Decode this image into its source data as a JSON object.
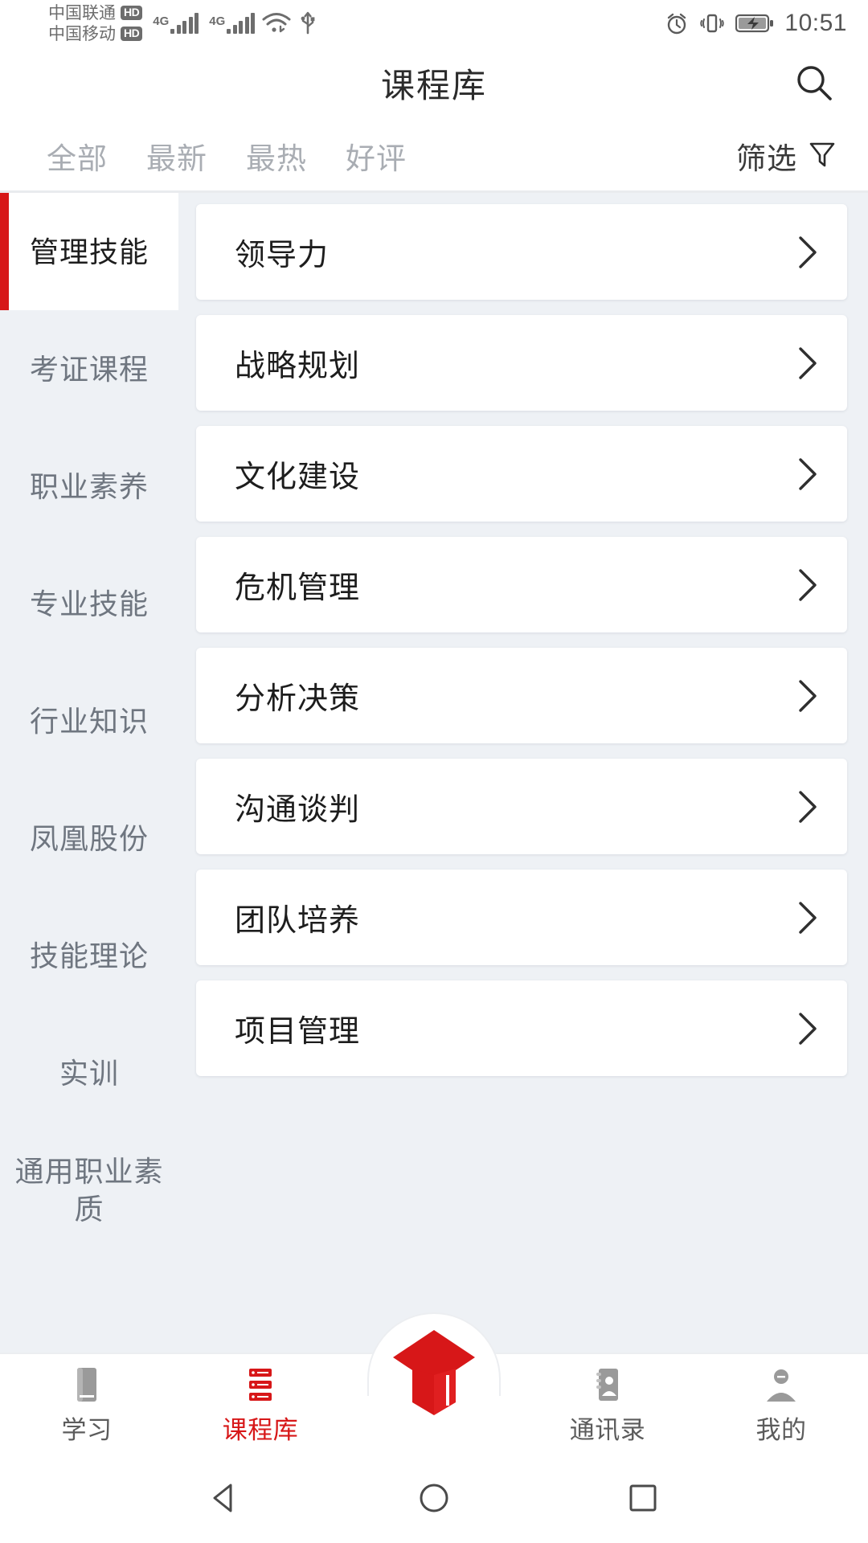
{
  "status_bar": {
    "carrier_1": "中国联通",
    "carrier_1_badge": "HD",
    "carrier_2": "中国移动",
    "carrier_2_badge": "HD",
    "network_1": "4G",
    "network_2": "4G",
    "icons": [
      "wifi-icon",
      "usb-icon",
      "alarm-icon",
      "vibrate-icon",
      "battery-charging-icon"
    ],
    "time": "10:51"
  },
  "header": {
    "title": "课程库",
    "search_icon": "search-icon"
  },
  "tabs": {
    "items": [
      {
        "label": "全部",
        "active": true
      },
      {
        "label": "最新",
        "active": false
      },
      {
        "label": "最热",
        "active": false
      },
      {
        "label": "好评",
        "active": false
      }
    ],
    "filter_label": "筛选",
    "filter_icon": "funnel-icon"
  },
  "sidebar": {
    "items": [
      {
        "label": "管理技能",
        "active": true
      },
      {
        "label": "考证课程",
        "active": false
      },
      {
        "label": "职业素养",
        "active": false
      },
      {
        "label": "专业技能",
        "active": false
      },
      {
        "label": "行业知识",
        "active": false
      },
      {
        "label": "凤凰股份",
        "active": false
      },
      {
        "label": "技能理论",
        "active": false
      },
      {
        "label": "实训",
        "active": false
      },
      {
        "label": "通用职业素质",
        "active": false
      }
    ]
  },
  "course_list": {
    "items": [
      {
        "title": "领导力"
      },
      {
        "title": "战略规划"
      },
      {
        "title": "文化建设"
      },
      {
        "title": "危机管理"
      },
      {
        "title": "分析决策"
      },
      {
        "title": "沟通谈判"
      },
      {
        "title": "团队培养"
      },
      {
        "title": "项目管理"
      }
    ],
    "chevron_icon": "chevron-right-icon"
  },
  "bottom_nav": {
    "items": [
      {
        "label": "学习",
        "icon": "book-icon",
        "active": false
      },
      {
        "label": "课程库",
        "icon": "course-list-icon",
        "active": true
      },
      {
        "label": "",
        "icon": "graduation-cap-icon",
        "active": false
      },
      {
        "label": "通讯录",
        "icon": "contacts-icon",
        "active": false
      },
      {
        "label": "我的",
        "icon": "person-icon",
        "active": false
      }
    ]
  },
  "android_nav": {
    "back_icon": "triangle-back-icon",
    "home_icon": "circle-home-icon",
    "recents_icon": "square-recents-icon"
  },
  "colors": {
    "accent": "#d71718",
    "page_bg": "#eef1f5",
    "card_bg": "#ffffff",
    "muted_text": "#6f7680"
  }
}
